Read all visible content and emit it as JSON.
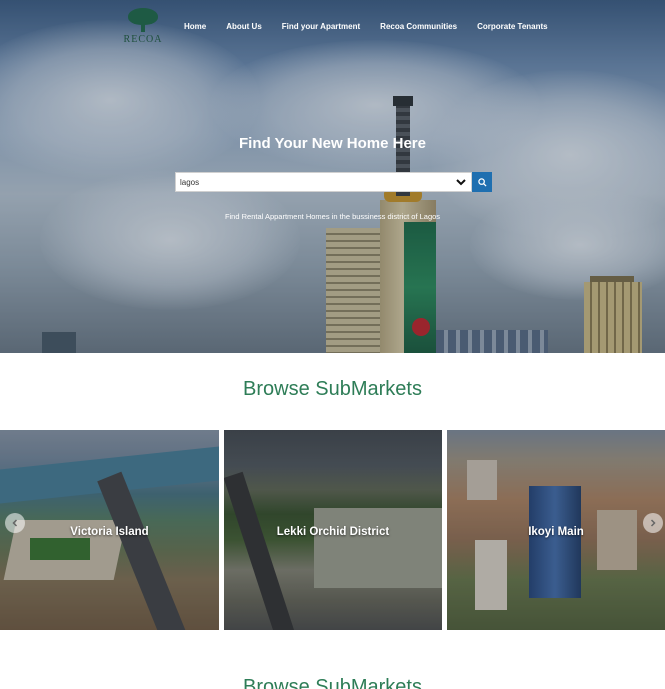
{
  "brand": {
    "logo_text": "RECOA"
  },
  "nav": {
    "items": [
      {
        "label": "Home"
      },
      {
        "label": "About Us"
      },
      {
        "label": "Find your Apartment"
      },
      {
        "label": "Recoa Communities"
      },
      {
        "label": "Corporate Tenants"
      }
    ]
  },
  "hero": {
    "title": "Find Your New Home Here",
    "search": {
      "selected": "lagos"
    },
    "subtitle": "Find Rental Appartment Homes in the bussiness district of Lagos"
  },
  "submarkets": {
    "title": "Browse SubMarkets",
    "cards": [
      {
        "label": "Victoria Island"
      },
      {
        "label": "Lekki Orchid District"
      },
      {
        "label": "Ikoyi Main"
      }
    ]
  },
  "submarkets_repeat": {
    "title": "Browse SubMarkets"
  },
  "colors": {
    "accent_green": "#2e7d57",
    "search_button": "#1f6fb0"
  }
}
